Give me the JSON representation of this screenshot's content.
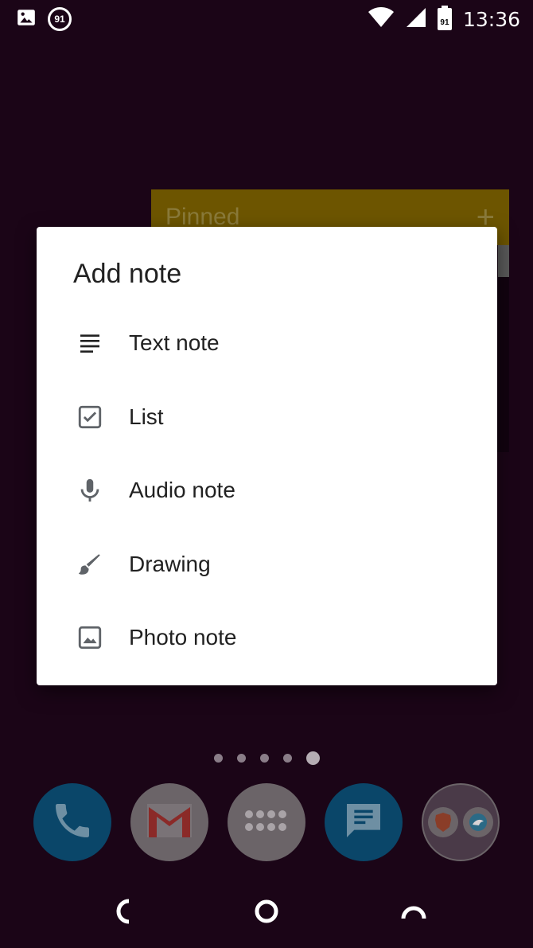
{
  "status_bar": {
    "notification_badge": "91",
    "battery_level": "91",
    "time": "13:36"
  },
  "widget": {
    "title": "Pinned",
    "add_symbol": "+"
  },
  "dialog": {
    "title": "Add note",
    "items": [
      {
        "label": "Text note",
        "icon": "text-lines-icon"
      },
      {
        "label": "List",
        "icon": "checkbox-icon"
      },
      {
        "label": "Audio note",
        "icon": "microphone-icon"
      },
      {
        "label": "Drawing",
        "icon": "brush-icon"
      },
      {
        "label": "Photo note",
        "icon": "image-icon"
      }
    ]
  },
  "home": {
    "page_count": 5,
    "active_page": 5,
    "dock_apps": [
      "phone-icon",
      "gmail-icon",
      "app-drawer-icon",
      "messages-icon",
      "folder-icon"
    ]
  },
  "colors": {
    "background": "#1b0517",
    "dialog_bg": "#ffffff",
    "text": "#212121",
    "icon": "#5f6368"
  }
}
